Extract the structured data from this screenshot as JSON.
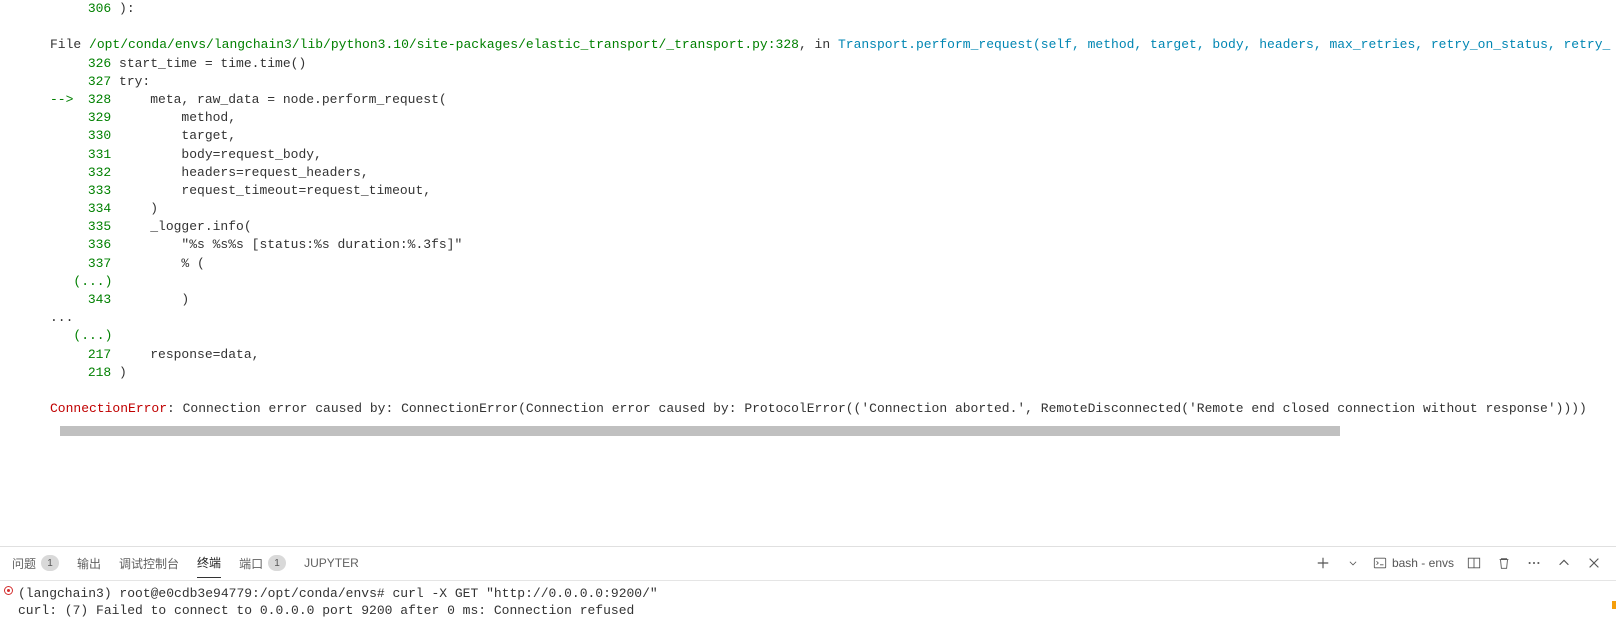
{
  "traceback": {
    "top_line": {
      "ln": "306",
      "code": "):"
    },
    "file_prefix": "File ",
    "file_path": "/opt/conda/envs/langchain3/lib/python3.10/site-packages/elastic_transport/_transport.py",
    "file_line": ":328",
    "file_sep": ", in ",
    "func_sig": "Transport.perform_request(self, method, target, body, headers, max_retries, retry_on_status, retry_",
    "lines": [
      {
        "prefix": "    ",
        "ln": "326",
        "code": " start_time = time.time()"
      },
      {
        "prefix": "    ",
        "ln": "327",
        "code": " try:"
      },
      {
        "prefix": "--> ",
        "ln": "328",
        "code": "     meta, raw_data = node.perform_request("
      },
      {
        "prefix": "    ",
        "ln": "329",
        "code": "         method,"
      },
      {
        "prefix": "    ",
        "ln": "330",
        "code": "         target,"
      },
      {
        "prefix": "    ",
        "ln": "331",
        "code": "         body=request_body,"
      },
      {
        "prefix": "    ",
        "ln": "332",
        "code": "         headers=request_headers,"
      },
      {
        "prefix": "    ",
        "ln": "333",
        "code": "         request_timeout=request_timeout,"
      },
      {
        "prefix": "    ",
        "ln": "334",
        "code": "     )"
      },
      {
        "prefix": "    ",
        "ln": "335",
        "code": "     _logger.info("
      },
      {
        "prefix": "    ",
        "ln": "336",
        "code": "         \"%s %s%s [status:%s duration:%.3fs]\""
      },
      {
        "prefix": "    ",
        "ln": "337",
        "code": "         % ("
      }
    ],
    "ellipsis1": "   (...)",
    "line343": {
      "prefix": "    ",
      "ln": "343",
      "code": "         )"
    },
    "dots": "...",
    "ellipsis2": "   (...)",
    "line217": {
      "prefix": "    ",
      "ln": "217",
      "code": "     response=data,"
    },
    "line218": {
      "prefix": "    ",
      "ln": "218",
      "code": " )"
    },
    "error_name": "ConnectionError",
    "error_msg": ": Connection error caused by: ConnectionError(Connection error caused by: ProtocolError(('Connection aborted.', RemoteDisconnected('Remote end closed connection without response'))))"
  },
  "tabs": {
    "problems": "问题",
    "problems_count": "1",
    "output": "输出",
    "debug": "调试控制台",
    "terminal": "终端",
    "ports": "端口",
    "ports_count": "1",
    "jupyter": "JUPYTER"
  },
  "panel": {
    "term_name": "bash - envs"
  },
  "terminal": {
    "prompt_env": "(langchain3) ",
    "prompt_userhost": "root@e0cdb3e94779:/opt/conda/envs# ",
    "command": "curl -X GET \"http://0.0.0.0:9200/\"",
    "output": "curl: (7) Failed to connect to 0.0.0.0 port 9200 after 0 ms: Connection refused"
  }
}
